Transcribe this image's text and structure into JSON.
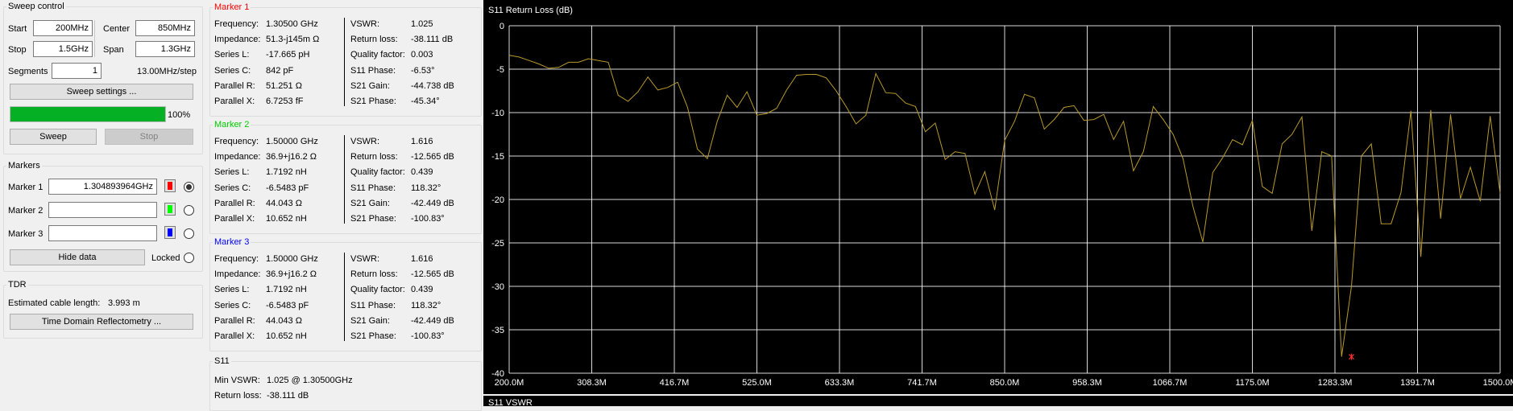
{
  "sweep_control": {
    "title": "Sweep control",
    "start_label": "Start",
    "start_value": "200MHz",
    "center_label": "Center",
    "center_value": "850MHz",
    "stop_label": "Stop",
    "stop_value": "1.5GHz",
    "span_label": "Span",
    "span_value": "1.3GHz",
    "segments_label": "Segments",
    "segments_value": "1",
    "step_text": "13.00MHz/step",
    "settings_button": "Sweep settings ...",
    "progress_percent": 100,
    "progress_text": "100%",
    "progress_color": "#06b025",
    "sweep_button": "Sweep",
    "stop_button": "Stop"
  },
  "markers_panel": {
    "title": "Markers",
    "items": [
      {
        "label": "Marker 1",
        "value": "1.304893964GHz",
        "color": "#ff0000",
        "selected": true
      },
      {
        "label": "Marker 2",
        "value": "",
        "color": "#00ff00",
        "selected": false
      },
      {
        "label": "Marker 3",
        "value": "",
        "color": "#0000ff",
        "selected": false
      }
    ],
    "hide_data_button": "Hide data",
    "locked_label": "Locked"
  },
  "tdr": {
    "title": "TDR",
    "cable_length_label": "Estimated cable length:",
    "cable_length_value": "3.993 m",
    "button": "Time Domain Reflectometry ..."
  },
  "marker_details": [
    {
      "title": "Marker 1",
      "title_color": "#ff0000",
      "left": [
        {
          "k": "Frequency:",
          "v": "1.30500 GHz"
        },
        {
          "k": "Impedance:",
          "v": "51.3-j145m Ω"
        },
        {
          "k": "Series L:",
          "v": "-17.665 pH"
        },
        {
          "k": "Series C:",
          "v": "842 pF"
        },
        {
          "k": "Parallel R:",
          "v": "51.251 Ω"
        },
        {
          "k": "Parallel X:",
          "v": "6.7253 fF"
        }
      ],
      "right": [
        {
          "k": "VSWR:",
          "v": "1.025"
        },
        {
          "k": "Return loss:",
          "v": "-38.111 dB"
        },
        {
          "k": "Quality factor:",
          "v": "0.003"
        },
        {
          "k": "S11 Phase:",
          "v": "-6.53°"
        },
        {
          "k": "S21 Gain:",
          "v": "-44.738 dB"
        },
        {
          "k": "S21 Phase:",
          "v": "-45.34°"
        }
      ]
    },
    {
      "title": "Marker 2",
      "title_color": "#00cc00",
      "left": [
        {
          "k": "Frequency:",
          "v": "1.50000 GHz"
        },
        {
          "k": "Impedance:",
          "v": "36.9+j16.2 Ω"
        },
        {
          "k": "Series L:",
          "v": "1.7192 nH"
        },
        {
          "k": "Series C:",
          "v": "-6.5483 pF"
        },
        {
          "k": "Parallel R:",
          "v": "44.043 Ω"
        },
        {
          "k": "Parallel X:",
          "v": "10.652 nH"
        }
      ],
      "right": [
        {
          "k": "VSWR:",
          "v": "1.616"
        },
        {
          "k": "Return loss:",
          "v": "-12.565 dB"
        },
        {
          "k": "Quality factor:",
          "v": "0.439"
        },
        {
          "k": "S11 Phase:",
          "v": "118.32°"
        },
        {
          "k": "S21 Gain:",
          "v": "-42.449 dB"
        },
        {
          "k": "S21 Phase:",
          "v": "-100.83°"
        }
      ]
    },
    {
      "title": "Marker 3",
      "title_color": "#0000ff",
      "left": [
        {
          "k": "Frequency:",
          "v": "1.50000 GHz"
        },
        {
          "k": "Impedance:",
          "v": "36.9+j16.2 Ω"
        },
        {
          "k": "Series L:",
          "v": "1.7192 nH"
        },
        {
          "k": "Series C:",
          "v": "-6.5483 pF"
        },
        {
          "k": "Parallel R:",
          "v": "44.043 Ω"
        },
        {
          "k": "Parallel X:",
          "v": "10.652 nH"
        }
      ],
      "right": [
        {
          "k": "VSWR:",
          "v": "1.616"
        },
        {
          "k": "Return loss:",
          "v": "-12.565 dB"
        },
        {
          "k": "Quality factor:",
          "v": "0.439"
        },
        {
          "k": "S11 Phase:",
          "v": "118.32°"
        },
        {
          "k": "S21 Gain:",
          "v": "-42.449 dB"
        },
        {
          "k": "S21 Phase:",
          "v": "-100.83°"
        }
      ]
    }
  ],
  "s11_summary": {
    "title": "S11",
    "min_vswr_label": "Min VSWR:",
    "min_vswr_value": "1.025 @ 1.30500GHz",
    "return_loss_label": "Return loss:",
    "return_loss_value": "-38.111 dB"
  },
  "second_chart_title": "S11 VSWR",
  "chart_data": {
    "type": "line",
    "title": "S11 Return Loss (dB)",
    "xlabel": "",
    "ylabel": "",
    "x_unit": "MHz",
    "xlim": [
      200.0,
      1500.0
    ],
    "ylim": [
      -40,
      0
    ],
    "x_ticks": [
      "200.0M",
      "308.3M",
      "416.7M",
      "525.0M",
      "633.3M",
      "741.7M",
      "850.0M",
      "958.3M",
      "1066.7M",
      "1175.0M",
      "1283.3M",
      "1391.7M",
      "1500.0M"
    ],
    "y_ticks": [
      "0",
      "-5",
      "-10",
      "-15",
      "-20",
      "-25",
      "-30",
      "-35",
      "-40"
    ],
    "grid": true,
    "background": "#000000",
    "grid_color": "#ffffff",
    "line_color": "#b89a2a",
    "marker_color": "#ff3030",
    "series": [
      {
        "x": [
          200,
          213,
          226,
          239,
          252,
          265,
          278,
          291,
          304,
          317,
          330,
          343,
          356,
          369,
          382,
          395,
          408,
          421,
          434,
          447,
          460,
          473,
          486,
          499,
          512,
          525,
          538,
          551,
          564,
          577,
          590,
          603,
          616,
          629,
          642,
          655,
          668,
          681,
          694,
          707,
          720,
          733,
          746,
          759,
          772,
          785,
          798,
          811,
          824,
          837,
          850,
          863,
          876,
          889,
          902,
          915,
          928,
          941,
          954,
          967,
          980,
          993,
          1006,
          1019,
          1032,
          1045,
          1058,
          1071,
          1084,
          1097,
          1110,
          1123,
          1136,
          1149,
          1162,
          1175,
          1188,
          1201,
          1214,
          1227,
          1240,
          1253,
          1266,
          1279,
          1292,
          1305,
          1318,
          1331,
          1344,
          1357,
          1370,
          1383,
          1396,
          1409,
          1422,
          1435,
          1448,
          1461,
          1474,
          1487,
          1500
        ],
        "y": [
          -3.4,
          -3.6,
          -4.0,
          -4.4,
          -4.9,
          -4.8,
          -4.2,
          -4.2,
          -3.8,
          -4.0,
          -4.2,
          -8.0,
          -8.7,
          -7.6,
          -5.9,
          -7.4,
          -7.1,
          -6.5,
          -9.4,
          -14.2,
          -15.3,
          -11.0,
          -8.0,
          -9.4,
          -7.6,
          -10.3,
          -10.1,
          -9.5,
          -7.4,
          -5.7,
          -5.6,
          -5.6,
          -6.0,
          -7.5,
          -9.3,
          -11.3,
          -10.3,
          -5.5,
          -7.7,
          -7.8,
          -8.9,
          -9.3,
          -12.2,
          -11.2,
          -15.4,
          -14.5,
          -14.7,
          -19.4,
          -16.8,
          -21.2,
          -13.2,
          -11.0,
          -7.9,
          -8.3,
          -11.9,
          -10.8,
          -9.4,
          -9.2,
          -10.9,
          -10.8,
          -10.2,
          -13.1,
          -11.0,
          -16.7,
          -14.5,
          -9.3,
          -10.8,
          -12.5,
          -15.3,
          -20.8,
          -24.9,
          -16.9,
          -15.2,
          -13.1,
          -13.7,
          -10.9,
          -18.5,
          -19.3,
          -13.6,
          -12.5,
          -10.5,
          -23.6,
          -14.5,
          -15.0,
          -38.1,
          -30.0,
          -15.0,
          -13.6,
          -22.8,
          -22.8,
          -19.2,
          -9.8,
          -26.6,
          -9.7,
          -22.2,
          -10.2,
          -19.9,
          -16.3,
          -20.2,
          -10.4,
          -19.3
        ]
      }
    ],
    "marker": {
      "x": 1305.0,
      "y": -38.111
    }
  }
}
